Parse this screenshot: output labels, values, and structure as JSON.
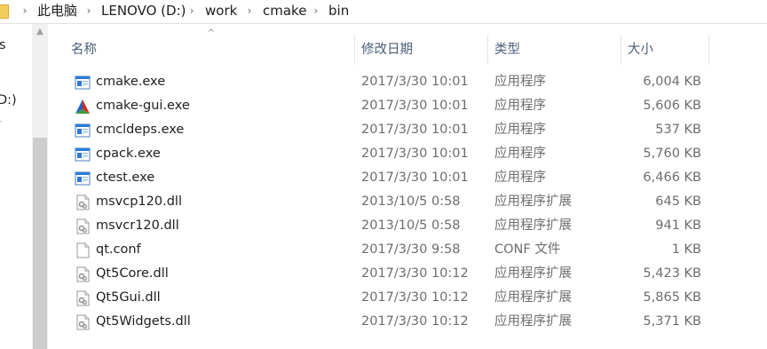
{
  "breadcrumb": {
    "items": [
      "此电脑",
      "LENOVO (D:)",
      "work",
      "cmake",
      "bin"
    ],
    "separator": "›"
  },
  "nav": {
    "items": [
      "s",
      "D:)",
      "r"
    ]
  },
  "columns": {
    "name": "名称",
    "date": "修改日期",
    "type": "类型",
    "size": "大小",
    "sort_indicator": "^"
  },
  "files": [
    {
      "name": "cmake.exe",
      "date": "2017/3/30 10:01",
      "type": "应用程序",
      "size": "6,004 KB",
      "icon": "exe-icon"
    },
    {
      "name": "cmake-gui.exe",
      "date": "2017/3/30 10:01",
      "type": "应用程序",
      "size": "5,606 KB",
      "icon": "cmake-gui-icon"
    },
    {
      "name": "cmcldeps.exe",
      "date": "2017/3/30 10:01",
      "type": "应用程序",
      "size": "537 KB",
      "icon": "exe-icon"
    },
    {
      "name": "cpack.exe",
      "date": "2017/3/30 10:01",
      "type": "应用程序",
      "size": "5,760 KB",
      "icon": "exe-icon"
    },
    {
      "name": "ctest.exe",
      "date": "2017/3/30 10:01",
      "type": "应用程序",
      "size": "6,466 KB",
      "icon": "exe-icon"
    },
    {
      "name": "msvcp120.dll",
      "date": "2013/10/5 0:58",
      "type": "应用程序扩展",
      "size": "645 KB",
      "icon": "dll-icon"
    },
    {
      "name": "msvcr120.dll",
      "date": "2013/10/5 0:58",
      "type": "应用程序扩展",
      "size": "941 KB",
      "icon": "dll-icon"
    },
    {
      "name": "qt.conf",
      "date": "2017/3/30 9:58",
      "type": "CONF 文件",
      "size": "1 KB",
      "icon": "conf-file-icon"
    },
    {
      "name": "Qt5Core.dll",
      "date": "2017/3/30 10:12",
      "type": "应用程序扩展",
      "size": "5,423 KB",
      "icon": "dll-icon"
    },
    {
      "name": "Qt5Gui.dll",
      "date": "2017/3/30 10:12",
      "type": "应用程序扩展",
      "size": "5,865 KB",
      "icon": "dll-icon"
    },
    {
      "name": "Qt5Widgets.dll",
      "date": "2017/3/30 10:12",
      "type": "应用程序扩展",
      "size": "5,371 KB",
      "icon": "dll-icon"
    }
  ],
  "colors": {
    "header_text": "#4c607a",
    "detail_text": "#6d6d6d",
    "exe_blue": "#2b7bd6",
    "folder_yellow": "#f4cd5c"
  }
}
